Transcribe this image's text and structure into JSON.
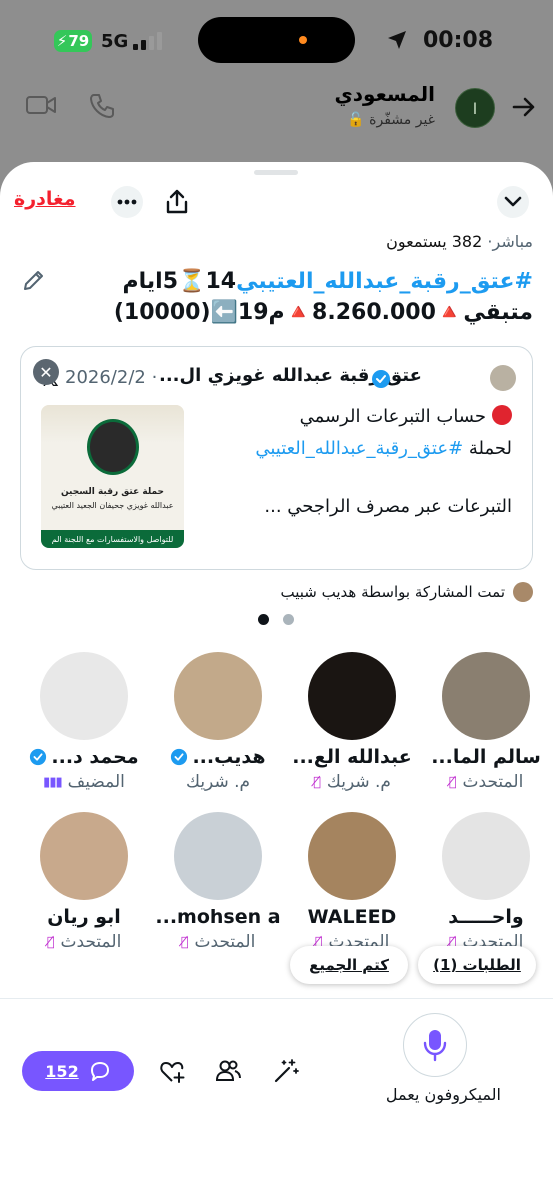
{
  "status": {
    "time": "00:08",
    "battery": "79",
    "network": "5G"
  },
  "dm": {
    "name": "المسعودي",
    "subtitle": "غير مشفّرة",
    "avatar_letter": "I"
  },
  "space": {
    "leave_label": "مغادرة",
    "live_label": "مباشر",
    "listeners": "382 يستمعون",
    "title_hashtag": "#عتق_رقبة_عبدالله_العتيبي",
    "title_rest": "14⏳5ايام متبقي🔺8.260.000🔺م19⬅️(10000)"
  },
  "tweet": {
    "date": "2026/2/2",
    "author": "عتق رقبة عبدالله غويزي ال...",
    "line1": "حساب التبرعات الرسمي",
    "line2_prefix": "لحملة ",
    "line2_hashtag": "#عتق_رقبة_عبدالله_العتيبي",
    "line3": "التبرعات عبر مصرف الراجحي  ...",
    "image_title": "حملة عتق رقبة السجين",
    "image_sub": "عبدالله غويزي جحيفان الجعيد العتيبي",
    "image_banner": "للتواصل والاستفسارات مع اللجنة الم"
  },
  "shared_by": "تمت المشاركة بواسطة هديب شبيب",
  "participants": [
    {
      "name": "سالم الما...",
      "role": "المتحدث",
      "avatar": "#8a7f70",
      "verified": false,
      "muted": true,
      "host": false
    },
    {
      "name": "عبدالله الع...",
      "role": "م. شريك",
      "avatar": "#1a1512",
      "verified": false,
      "muted": true,
      "host": false
    },
    {
      "name": "هديب...",
      "role": "م. شريك",
      "avatar": "#c2a98a",
      "verified": true,
      "muted": false,
      "host": false
    },
    {
      "name": "محمد د...",
      "role": "المضيف",
      "avatar": "#e8e8e8",
      "verified": true,
      "muted": false,
      "host": true
    },
    {
      "name": "واحـــــد",
      "role": "المتحدث",
      "avatar": "#e4e4e4",
      "verified": false,
      "muted": true,
      "host": false
    },
    {
      "name": "WALEED",
      "role": "المتحدث",
      "avatar": "#a5845f",
      "verified": false,
      "muted": true,
      "host": false
    },
    {
      "name": "mohsen a...",
      "role": "المتحدث",
      "avatar": "#c9d0d6",
      "verified": false,
      "muted": true,
      "host": false
    },
    {
      "name": "ابو ريان",
      "role": "المتحدث",
      "avatar": "#c8a98c",
      "verified": false,
      "muted": true,
      "host": false
    }
  ],
  "pills": {
    "requests": "الطلبات (1)",
    "mute_all": "كتم الجميع"
  },
  "bottom": {
    "mic_label": "الميكروفون يعمل",
    "comments": "152"
  },
  "colors": {
    "accent": "#7856ff",
    "link": "#1d9bf0",
    "danger": "#f4212e",
    "mute": "#c02fd0"
  }
}
